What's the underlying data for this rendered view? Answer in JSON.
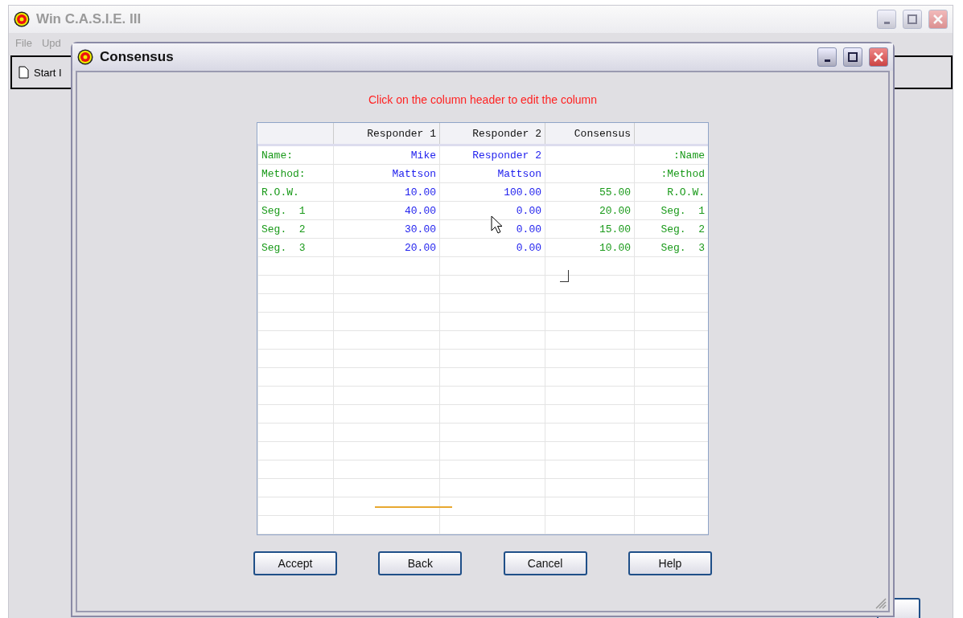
{
  "main_window": {
    "title": "Win C.A.S.I.E. III",
    "active": false,
    "menu": [
      "File",
      "Upd"
    ],
    "toolbar_item": "Start I"
  },
  "dialog": {
    "title": "Consensus",
    "active": true,
    "hint": "Click on the column header to edit the column",
    "table": {
      "columns": [
        {
          "kind": "label"
        },
        {
          "label": "Responder 1",
          "kind": "response"
        },
        {
          "label": "Responder 2",
          "kind": "response"
        },
        {
          "label": "Consensus",
          "kind": "consensus"
        },
        {
          "kind": "mirror"
        }
      ],
      "rows": [
        [
          "Name:",
          "Mike",
          "Responder 2",
          "",
          ":Name"
        ],
        [
          "Method:",
          "Mattson",
          "Mattson",
          "",
          ":Method"
        ],
        [
          "R.O.W.",
          "10.00",
          "100.00",
          "55.00",
          "R.O.W."
        ],
        [
          "Seg.  1",
          "40.00",
          "0.00",
          "20.00",
          "Seg.  1"
        ],
        [
          "Seg.  2",
          "30.00",
          "0.00",
          "15.00",
          "Seg.  2"
        ],
        [
          "Seg.  3",
          "20.00",
          "0.00",
          "10.00",
          "Seg.  3"
        ]
      ]
    },
    "buttons": [
      "Accept",
      "Back",
      "Cancel",
      "Help"
    ]
  }
}
